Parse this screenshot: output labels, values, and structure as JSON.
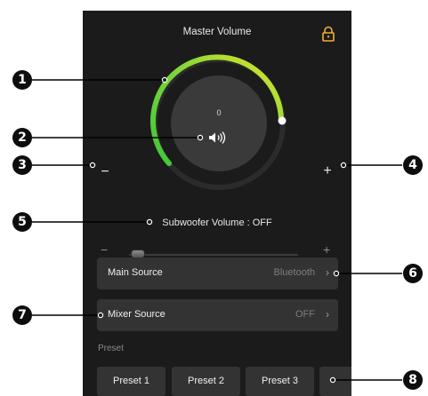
{
  "header": {
    "title": "Master Volume",
    "lock_icon": "lock-icon"
  },
  "master_volume": {
    "value": "0",
    "minus_label": "−",
    "plus_label": "+",
    "arc_colors": [
      "#4ccd32",
      "#e2e42a"
    ],
    "speaker_icon": "speaker-icon"
  },
  "subwoofer": {
    "label": "Subwoofer Volume : OFF",
    "minus_label": "−",
    "plus_label": "+"
  },
  "main_source": {
    "label": "Main Source",
    "value": "Bluetooth",
    "chevron": "›"
  },
  "mixer_source": {
    "label": "Mixer Source",
    "value": "OFF",
    "chevron": "›"
  },
  "preset": {
    "header": "Preset",
    "items": [
      {
        "label": "Preset 1"
      },
      {
        "label": "Preset 2"
      },
      {
        "label": "Preset 3"
      },
      {
        "label": ""
      }
    ]
  },
  "callouts": [
    "1",
    "2",
    "3",
    "4",
    "5",
    "6",
    "7",
    "8"
  ]
}
